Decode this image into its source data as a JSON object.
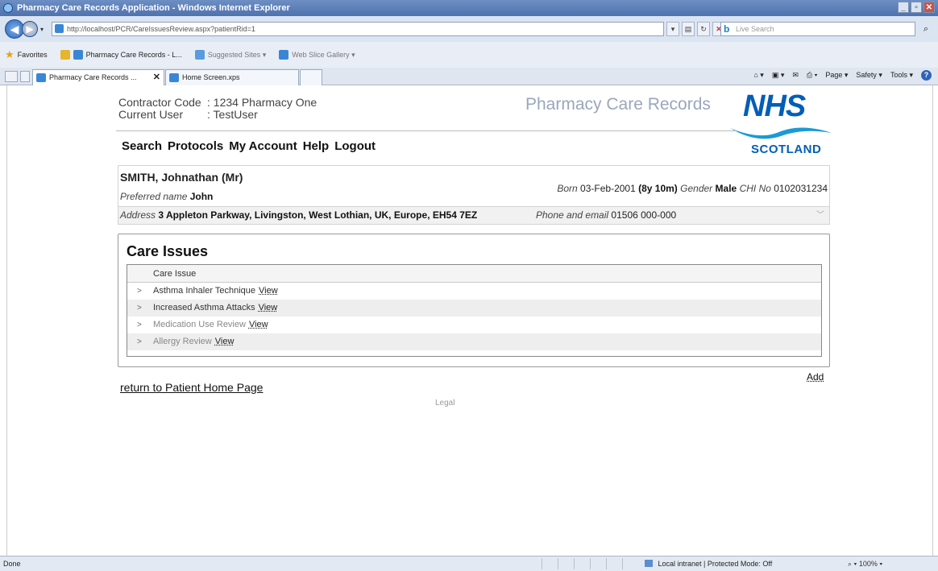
{
  "browser": {
    "window_title": "Pharmacy Care Records Application - Windows Internet Explorer",
    "url": "http://localhost/PCR/CareIssuesReview.aspx?patientRid=1",
    "search_placeholder": "Live Search",
    "favorites_label": "Favorites",
    "favorites": [
      {
        "label": "Pharmacy Care Records - L..."
      },
      {
        "label": "Suggested Sites ▾"
      },
      {
        "label": "Web Slice Gallery ▾"
      }
    ],
    "tabs": [
      {
        "label": "Pharmacy Care Records ..."
      },
      {
        "label": "Home Screen.xps"
      }
    ],
    "commands": {
      "page": "Page ▾",
      "safety": "Safety ▾",
      "tools": "Tools ▾"
    },
    "status": {
      "left": "Done",
      "zone": "Local intranet | Protected Mode: Off",
      "zoom": "100%"
    }
  },
  "header": {
    "contractor_label": "Contractor Code",
    "contractor_value": ": 1234 Pharmacy One",
    "user_label": "Current User",
    "user_value": ": TestUser",
    "app_title": "Pharmacy Care Records",
    "logo": {
      "nhs": "NHS",
      "region": "SCOTLAND"
    }
  },
  "nav": {
    "search": "Search",
    "protocols": "Protocols",
    "account": "My Account",
    "help": "Help",
    "logout": "Logout"
  },
  "patient": {
    "name": "SMITH, Johnathan (Mr)",
    "preferred_label": "Preferred name",
    "preferred_value": "John",
    "born_label": "Born",
    "born_value": "03-Feb-2001",
    "age": "(8y 10m)",
    "gender_label": "Gender",
    "gender_value": "Male",
    "chi_label": "CHI No",
    "chi_value": "0102031234",
    "address_label": "Address",
    "address_value": "3 Appleton Parkway, Livingston, West Lothian, UK, Europe, EH54 7EZ",
    "phone_label": "Phone and email",
    "phone_value": "01506 000-000"
  },
  "care_issues": {
    "title": "Care Issues",
    "column_header": "Care Issue",
    "view_label": "View",
    "rows": [
      {
        "issue": "Asthma Inhaler Technique"
      },
      {
        "issue": "Increased Asthma Attacks"
      },
      {
        "issue": "Medication Use Review"
      },
      {
        "issue": "Allergy Review"
      }
    ]
  },
  "footer": {
    "add": "Add",
    "return": "return to Patient Home Page",
    "legal": "Legal"
  }
}
